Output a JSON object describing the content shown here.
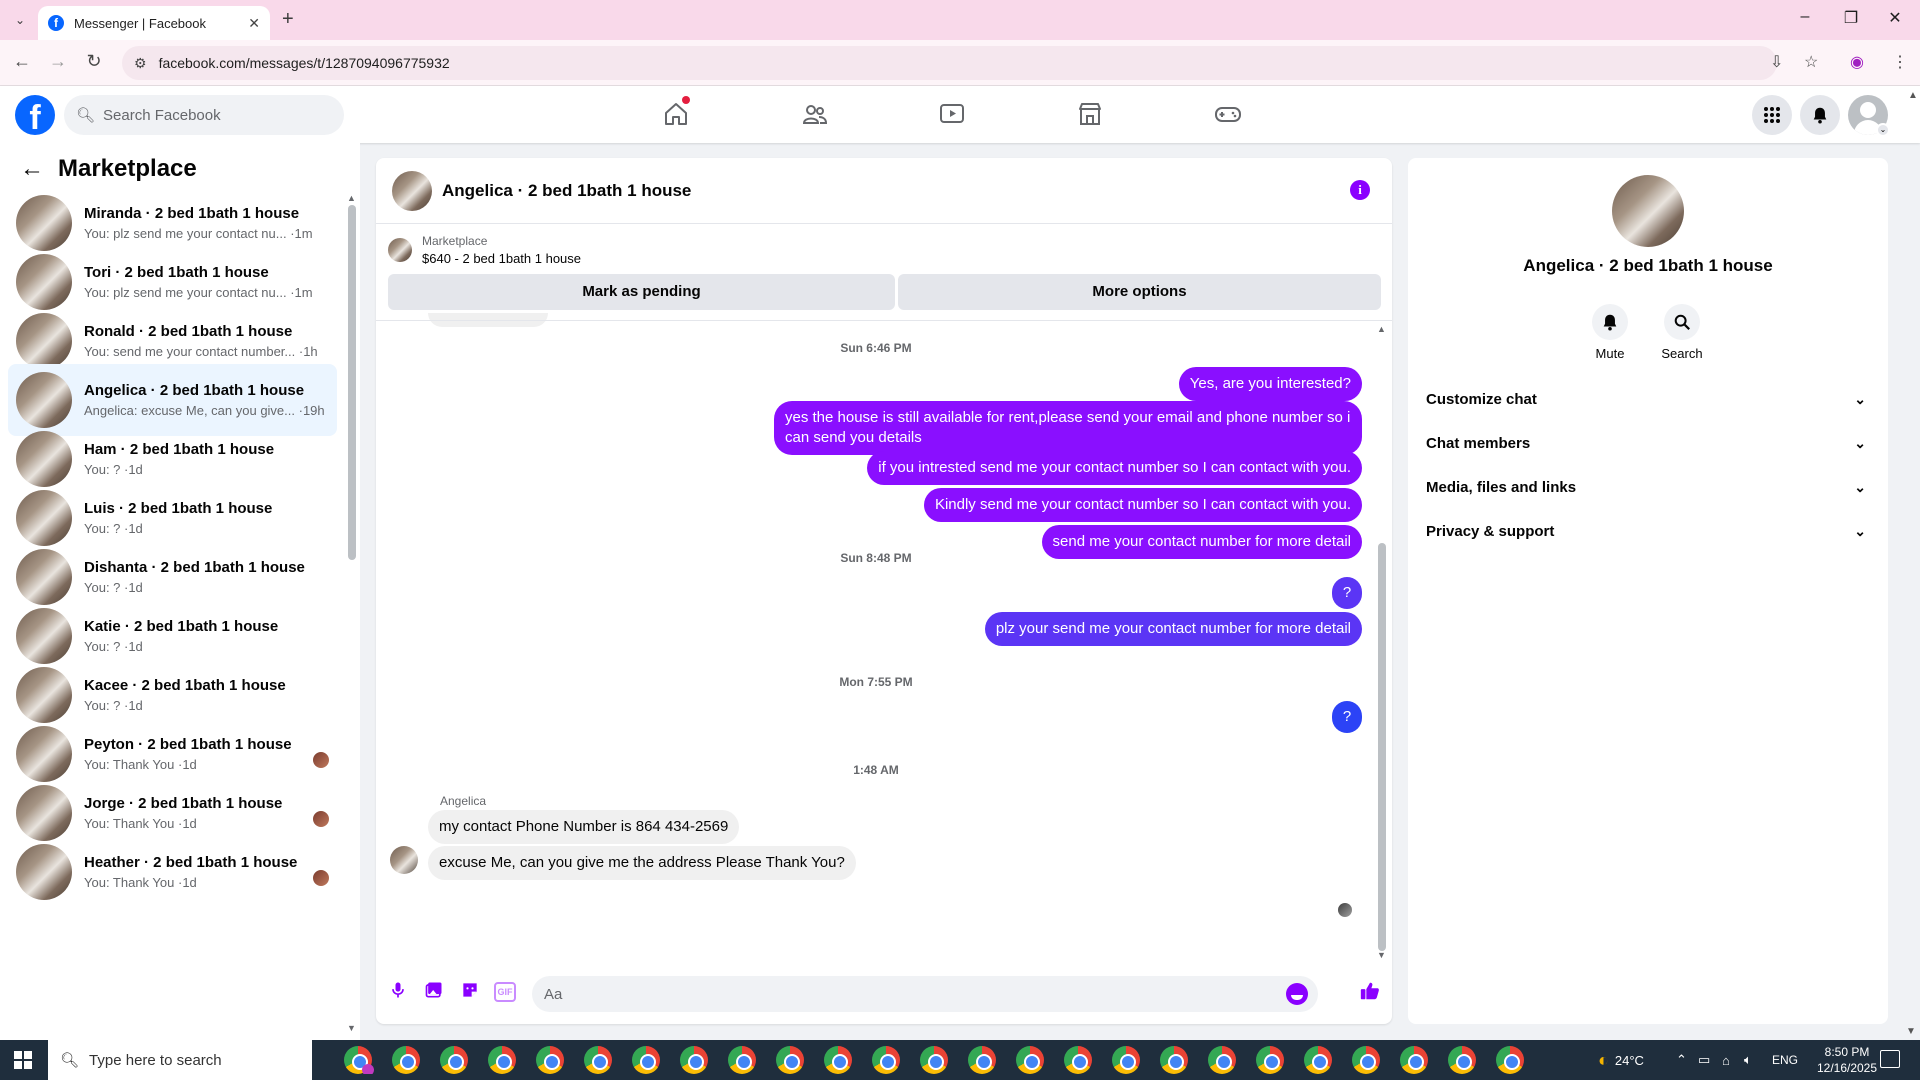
{
  "browser": {
    "tab_title": "Messenger | Facebook",
    "url": "facebook.com/messages/t/1287094096775932",
    "new_tab_label": "+",
    "minimize": "–",
    "maximize": "❐",
    "close": "✕"
  },
  "fb_header": {
    "logo_text": "f",
    "search_placeholder": "Search Facebook",
    "nav_icons": [
      "home-icon",
      "friends-icon",
      "video-icon",
      "marketplace-icon",
      "gaming-icon"
    ],
    "right_icons": [
      "menu-grid-icon",
      "messenger-icon",
      "account-icon"
    ]
  },
  "sidebar": {
    "title": "Marketplace",
    "chats": [
      {
        "name": "Miranda · 2 bed 1bath 1 house",
        "preview": "You: plz send me your contact nu... ·1m",
        "active": false,
        "seen": false
      },
      {
        "name": "Tori · 2 bed 1bath 1 house",
        "preview": "You: plz send me your contact nu... ·1m",
        "active": false,
        "seen": false
      },
      {
        "name": "Ronald · 2 bed 1bath 1 house",
        "preview": "You: send me your contact number... ·1h",
        "active": false,
        "seen": false
      },
      {
        "name": "Angelica · 2 bed 1bath 1 house",
        "preview": "Angelica: excuse Me, can you give... ·19h",
        "active": true,
        "seen": false
      },
      {
        "name": "Ham · 2 bed 1bath 1 house",
        "preview": "You: ? ·1d",
        "active": false,
        "seen": false
      },
      {
        "name": "Luis · 2 bed 1bath 1 house",
        "preview": "You: ? ·1d",
        "active": false,
        "seen": false
      },
      {
        "name": "Dishanta · 2 bed 1bath 1 house",
        "preview": "You: ? ·1d",
        "active": false,
        "seen": false
      },
      {
        "name": "Katie · 2 bed 1bath 1 house",
        "preview": "You: ? ·1d",
        "active": false,
        "seen": false
      },
      {
        "name": "Kacee · 2 bed 1bath 1 house",
        "preview": "You: ? ·1d",
        "active": false,
        "seen": false
      },
      {
        "name": "Peyton · 2 bed 1bath 1 house",
        "preview": "You: Thank You ·1d",
        "active": false,
        "seen": true
      },
      {
        "name": "Jorge · 2 bed 1bath 1 house",
        "preview": "You: Thank You ·1d",
        "active": false,
        "seen": true
      },
      {
        "name": "Heather · 2 bed 1bath 1 house",
        "preview": "You: Thank You ·1d",
        "active": false,
        "seen": true
      }
    ]
  },
  "chat": {
    "title": "Angelica · 2 bed 1bath 1 house",
    "listing_source": "Marketplace",
    "listing_detail": "$640 - 2 bed 1bath 1 house",
    "mark_pending_label": "Mark as pending",
    "more_options_label": "More options",
    "timestamps": [
      "Sun 6:46 PM",
      "Sun 8:48 PM",
      "Mon 7:55 PM",
      "1:48 AM"
    ],
    "outgoing_block1": [
      "Yes, are you interested?",
      "yes the house is still available for rent,please send your email and phone number so i can send you details",
      "if you intrested send me your contact number so I can contact with you.",
      "Kindly send me your contact number so I can contact with you.",
      "send me your contact number for more detail"
    ],
    "q1": "?",
    "outgoing_block2": "plz your send me your contact number for more detail",
    "q2": "?",
    "sender_name": "Angelica",
    "incoming": [
      "my contact Phone Number is  864 434-2569",
      "excuse Me, can you give me the address Please Thank You?"
    ],
    "composer_placeholder": "Aa",
    "gif_label": "GIF"
  },
  "info_panel": {
    "name": "Angelica · 2 bed 1bath 1 house",
    "mute_label": "Mute",
    "search_label": "Search",
    "rows": [
      "Customize chat",
      "Chat members",
      "Media, files and links",
      "Privacy & support"
    ]
  },
  "taskbar": {
    "search_placeholder": "Type here to search",
    "weather": "24°C",
    "language": "ENG",
    "time": "8:50 PM",
    "date": "12/16/2025"
  },
  "colors": {
    "accent_purple": "#8a0fff",
    "accent_blue": "#5b35f5",
    "fb_blue": "#0866ff",
    "active_chat_bg": "#ebf5ff"
  }
}
